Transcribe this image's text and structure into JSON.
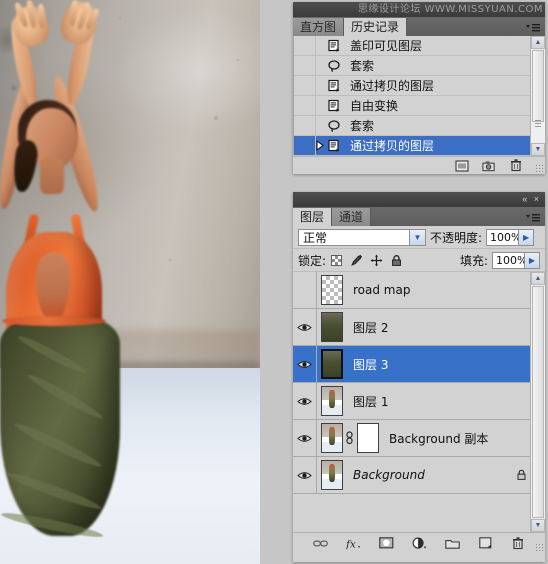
{
  "app": {
    "watermark": "思缘设计论坛 WWW.MISSYUAN.COM"
  },
  "history_panel": {
    "tabs": [
      {
        "label": "直方图",
        "active": false
      },
      {
        "label": "历史记录",
        "active": true
      }
    ],
    "menu_icon": "panel-menu-icon",
    "items": [
      {
        "label": "盖印可见图层",
        "icon": "layer-icon",
        "selected": false,
        "current": false
      },
      {
        "label": "套索",
        "icon": "lasso-icon",
        "selected": false,
        "current": false
      },
      {
        "label": "通过拷贝的图层",
        "icon": "layer-icon",
        "selected": false,
        "current": false
      },
      {
        "label": "自由变换",
        "icon": "layer-icon",
        "selected": false,
        "current": false
      },
      {
        "label": "套索",
        "icon": "lasso-icon",
        "selected": false,
        "current": false
      },
      {
        "label": "通过拷贝的图层",
        "icon": "layer-icon",
        "selected": true,
        "current": true
      }
    ],
    "footer_buttons": [
      {
        "name": "new-document-from-state-button",
        "icon": "document-icon"
      },
      {
        "name": "new-snapshot-button",
        "icon": "camera-icon"
      },
      {
        "name": "delete-state-button",
        "icon": "trash-icon"
      }
    ]
  },
  "layers_panel": {
    "window_buttons": {
      "collapse": "«",
      "close": "×"
    },
    "tabs": [
      {
        "label": "图层",
        "active": true
      },
      {
        "label": "通道",
        "active": false
      }
    ],
    "menu_icon": "panel-menu-icon",
    "blend_mode": {
      "label": "",
      "value": "正常"
    },
    "opacity": {
      "label": "不透明度:",
      "value": "100%"
    },
    "lock": {
      "label": "锁定:",
      "icons": [
        {
          "name": "lock-transparent-pixels-icon"
        },
        {
          "name": "lock-image-pixels-icon"
        },
        {
          "name": "lock-position-icon"
        },
        {
          "name": "lock-all-icon"
        }
      ]
    },
    "fill": {
      "label": "填充:",
      "value": "100%"
    },
    "layers": [
      {
        "name": "road map",
        "visible": false,
        "selected": false,
        "thumb": "empty",
        "italic": false,
        "locked": false,
        "mask": false,
        "linked": false
      },
      {
        "name": "图层 2",
        "visible": true,
        "selected": false,
        "thumb": "figure-crop",
        "italic": false,
        "locked": false,
        "mask": false,
        "linked": false
      },
      {
        "name": "图层 3",
        "visible": true,
        "selected": true,
        "thumb": "figure-crop",
        "italic": false,
        "locked": false,
        "mask": false,
        "linked": false
      },
      {
        "name": "图层 1",
        "visible": true,
        "selected": false,
        "thumb": "figure-full",
        "italic": false,
        "locked": false,
        "mask": false,
        "linked": false
      },
      {
        "name": "Background 副本",
        "visible": true,
        "selected": false,
        "thumb": "figure-full",
        "italic": false,
        "locked": false,
        "mask": true,
        "linked": true
      },
      {
        "name": "Background",
        "visible": true,
        "selected": false,
        "thumb": "figure-full",
        "italic": true,
        "locked": true,
        "mask": false,
        "linked": false
      }
    ],
    "footer_buttons": [
      {
        "name": "link-layers-button",
        "icon": "link-icon"
      },
      {
        "name": "layer-style-button",
        "icon": "fx-icon"
      },
      {
        "name": "add-layer-mask-button",
        "icon": "mask-icon"
      },
      {
        "name": "new-adjustment-layer-button",
        "icon": "adjustment-icon"
      },
      {
        "name": "new-group-button",
        "icon": "folder-icon"
      },
      {
        "name": "new-layer-button",
        "icon": "new-layer-icon"
      },
      {
        "name": "delete-layer-button",
        "icon": "trash-icon"
      }
    ]
  },
  "canvas": {
    "description": "dancer-photo"
  }
}
